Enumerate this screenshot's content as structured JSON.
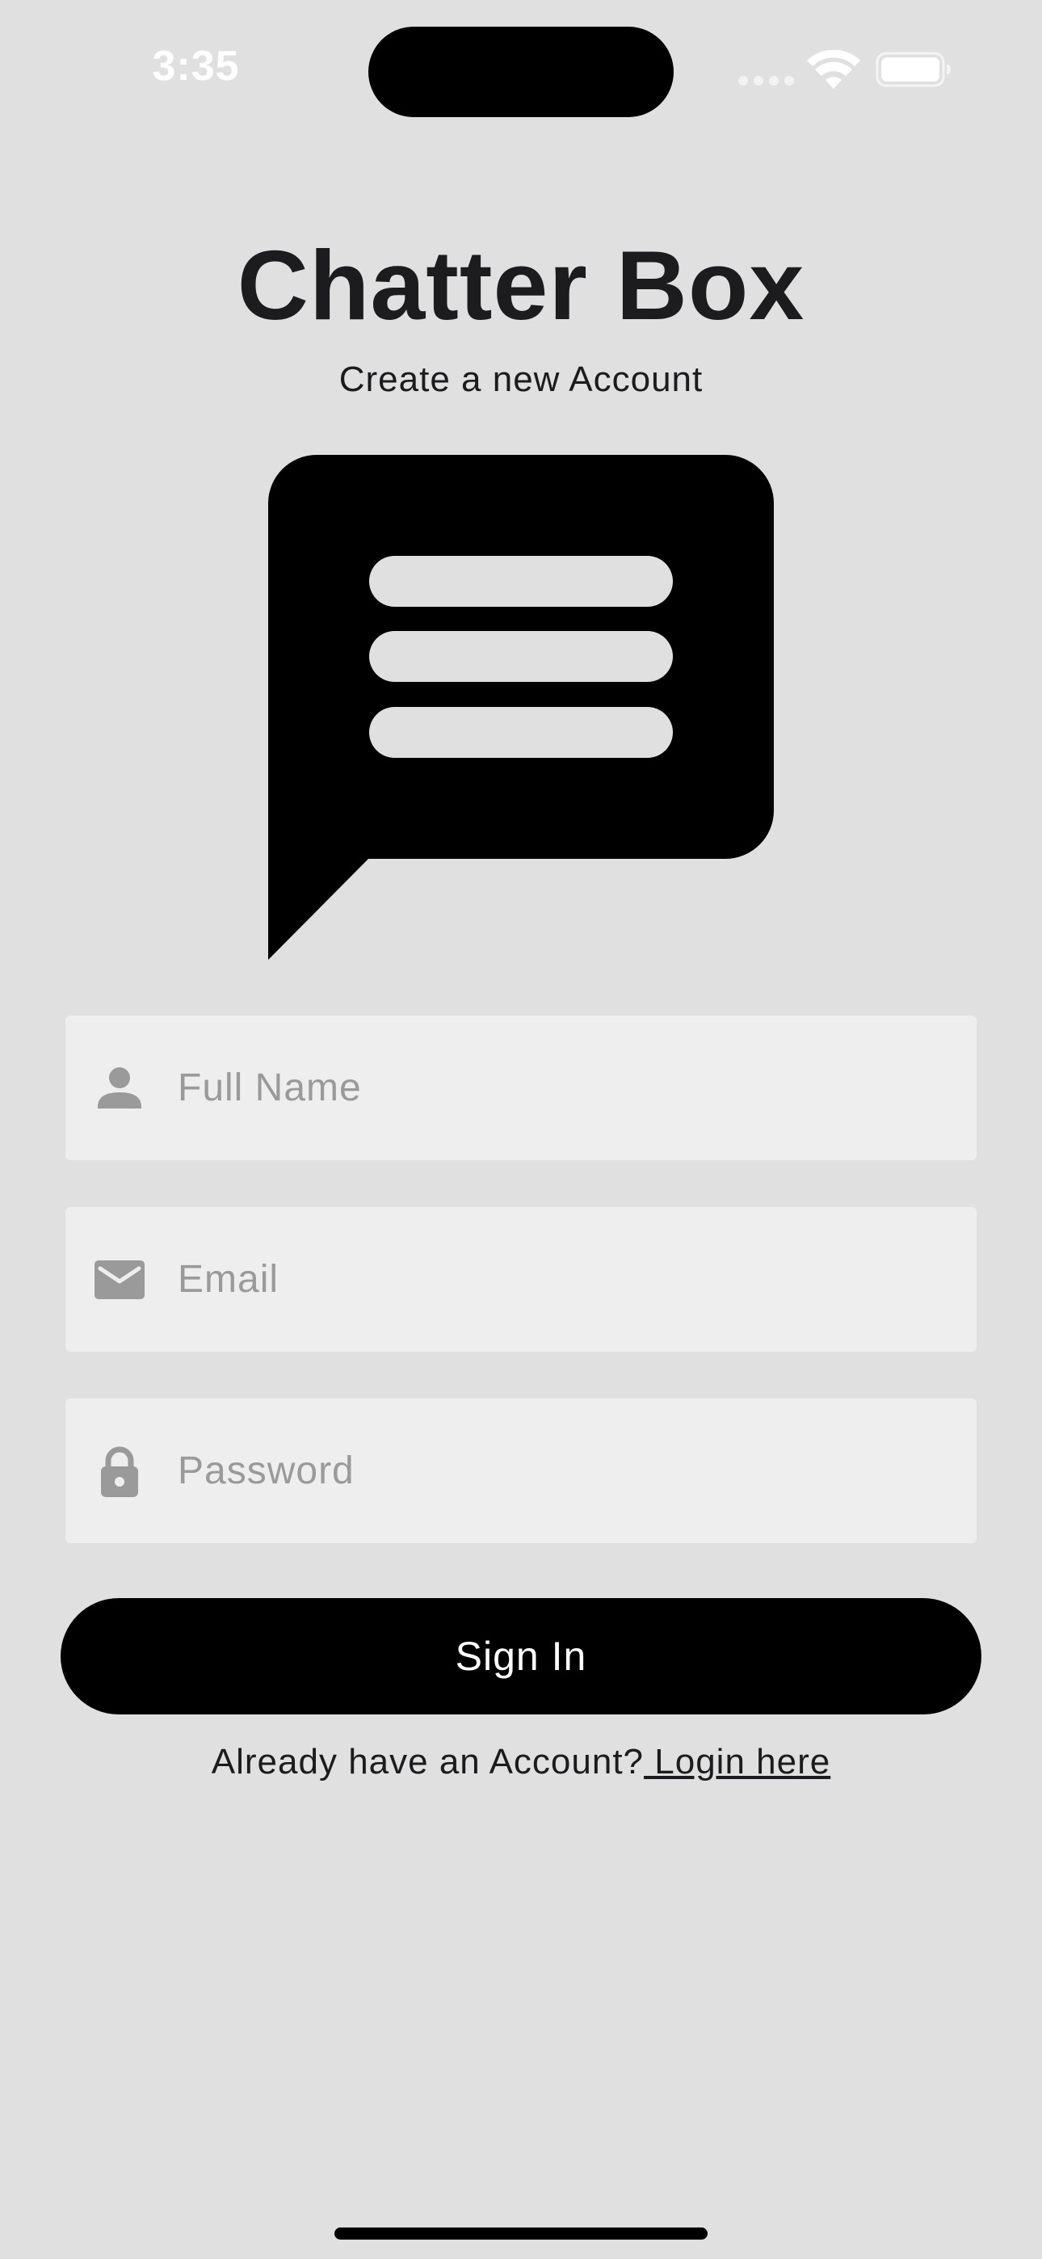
{
  "status_bar": {
    "time": "3:35"
  },
  "header": {
    "title": "Chatter Box",
    "subtitle": "Create a new Account"
  },
  "logo": {
    "icon": "chat-bubble-icon",
    "color": "#000000"
  },
  "form": {
    "full_name": {
      "placeholder": "Full Name",
      "value": "",
      "icon": "person-icon"
    },
    "email": {
      "placeholder": "Email",
      "value": "",
      "icon": "mail-icon"
    },
    "password": {
      "placeholder": "Password",
      "value": "",
      "icon": "lock-icon"
    },
    "submit_label": "Sign In"
  },
  "footer": {
    "prompt": "Already have an Account?",
    "link": " Login here"
  },
  "colors": {
    "background": "#e0e0e0",
    "field_background": "#eeeeee",
    "placeholder": "#9a9a9a",
    "icon": "#9a9a9a",
    "button": "#000000",
    "button_text": "#ffffff",
    "text": "#1c1c1e"
  }
}
